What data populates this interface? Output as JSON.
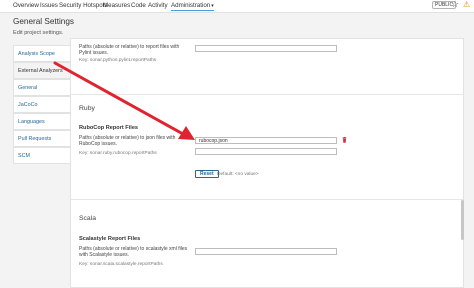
{
  "nav": {
    "tabs": [
      {
        "label": "Overview"
      },
      {
        "label": "Issues"
      },
      {
        "label": "Security Hotspots"
      },
      {
        "label": "Measures"
      },
      {
        "label": "Code"
      },
      {
        "label": "Activity"
      },
      {
        "label": "Administration"
      }
    ],
    "admin_caret": "▾",
    "visibility_badge": "PUBLIC",
    "star_glyph": "☆",
    "warning_glyph": "⚠"
  },
  "header": {
    "title": "General Settings",
    "subtitle": "Edit project settings."
  },
  "sidebar": {
    "items": [
      {
        "label": "Analysis Scope"
      },
      {
        "label": "External Analyzers"
      },
      {
        "label": "General"
      },
      {
        "label": "JaCoCo"
      },
      {
        "label": "Languages"
      },
      {
        "label": "Pull Requests"
      },
      {
        "label": "SCM"
      }
    ],
    "selected_index": 1
  },
  "python_field": {
    "description": "Paths (absolute or relative) to report files with Pylint issues.",
    "key": "Key: sonar.python.pylint.reportPaths",
    "value": ""
  },
  "ruby": {
    "section_title": "Ruby",
    "field_title": "RuboCop Report Files",
    "description": "Paths (absolute or relative) to json files with RuboCop issues.",
    "key": "Key: sonar.ruby.rubocop.reportPaths",
    "value": "rubocop.json",
    "extra_value": "",
    "reset_label": "Reset",
    "default_note": "Default: <no value>"
  },
  "scala": {
    "section_title": "Scala",
    "field_title": "Scalastyle Report Files",
    "description": "Paths (absolute or relative) to scalastyle xml files with Scalastyle issues.",
    "key": "Key: sonar.scala.scalastyle.reportPaths",
    "value": ""
  },
  "colors": {
    "link": "#236a97",
    "annotation_arrow": "#e0242f",
    "trash": "#d02f3a"
  }
}
